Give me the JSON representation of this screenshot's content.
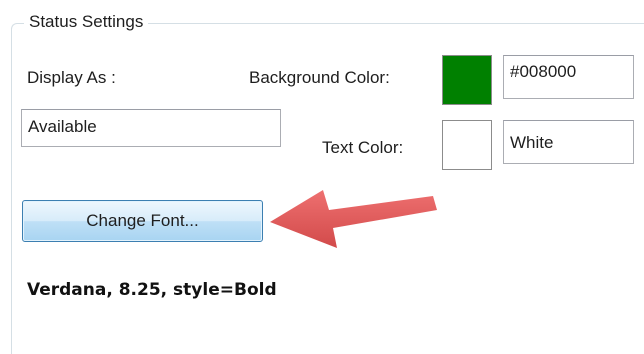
{
  "group": {
    "title": "Status Settings"
  },
  "display_as": {
    "label": "Display As :",
    "value": "Available"
  },
  "background_color": {
    "label": "Background Color:",
    "swatch_color": "#008000",
    "value": "#008000"
  },
  "text_color": {
    "label": "Text Color:",
    "swatch_color": "#FFFFFF",
    "value": "White"
  },
  "change_font_button": {
    "label": "Change Font..."
  },
  "font_info": {
    "text": "Verdana, 8.25, style=Bold"
  },
  "annotation": {
    "arrow_color": "#e05050",
    "icon": "red-arrow-icon"
  }
}
